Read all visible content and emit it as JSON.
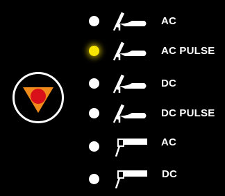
{
  "panel": {
    "selector": {
      "icon": "red-dot-on-orange-triangle-icon",
      "colors": {
        "triangle": "#f08a1a",
        "dot": "#d90f1a"
      }
    },
    "modes": [
      {
        "label": "AC",
        "led": "off",
        "torch": "tig-torch-icon"
      },
      {
        "label": "AC PULSE",
        "led": "on",
        "torch": "tig-torch-icon"
      },
      {
        "label": "DC",
        "led": "off",
        "torch": "tig-torch-icon"
      },
      {
        "label": "DC PULSE",
        "led": "off",
        "torch": "tig-torch-icon"
      },
      {
        "label": "AC",
        "led": "off",
        "torch": "mma-electrode-holder-icon"
      },
      {
        "label": "DC",
        "led": "off",
        "torch": "mma-electrode-holder-icon"
      }
    ],
    "colors": {
      "led_on": "#f7e500",
      "led_off": "#ffffff",
      "background": "#000000"
    }
  }
}
